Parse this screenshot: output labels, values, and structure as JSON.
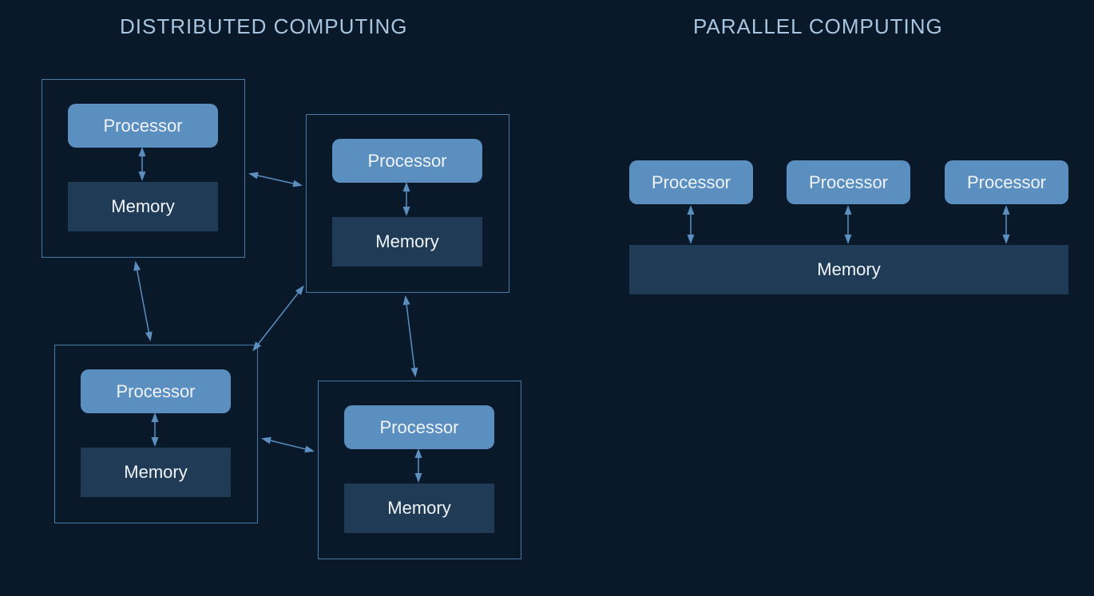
{
  "titles": {
    "distributed": "DISTRIBUTED COMPUTING",
    "parallel": "PARALLEL COMPUTING"
  },
  "labels": {
    "processor": "Processor",
    "memory": "Memory"
  },
  "colors": {
    "background": "#0a1929",
    "processor_box": "#5a8fc0",
    "memory_box": "#1f3b56",
    "text": "#f0f4f8",
    "title_text": "#a8c5e0",
    "border": "#4a7aa8",
    "arrow": "#5a8fc0"
  },
  "distributed": {
    "nodes": [
      {
        "id": 1,
        "processor": "Processor",
        "memory": "Memory"
      },
      {
        "id": 2,
        "processor": "Processor",
        "memory": "Memory"
      },
      {
        "id": 3,
        "processor": "Processor",
        "memory": "Memory"
      },
      {
        "id": 4,
        "processor": "Processor",
        "memory": "Memory"
      }
    ],
    "connections": [
      [
        1,
        2
      ],
      [
        1,
        3
      ],
      [
        2,
        3
      ],
      [
        2,
        4
      ],
      [
        3,
        4
      ]
    ]
  },
  "parallel": {
    "processors": [
      "Processor",
      "Processor",
      "Processor"
    ],
    "shared_memory": "Memory"
  }
}
